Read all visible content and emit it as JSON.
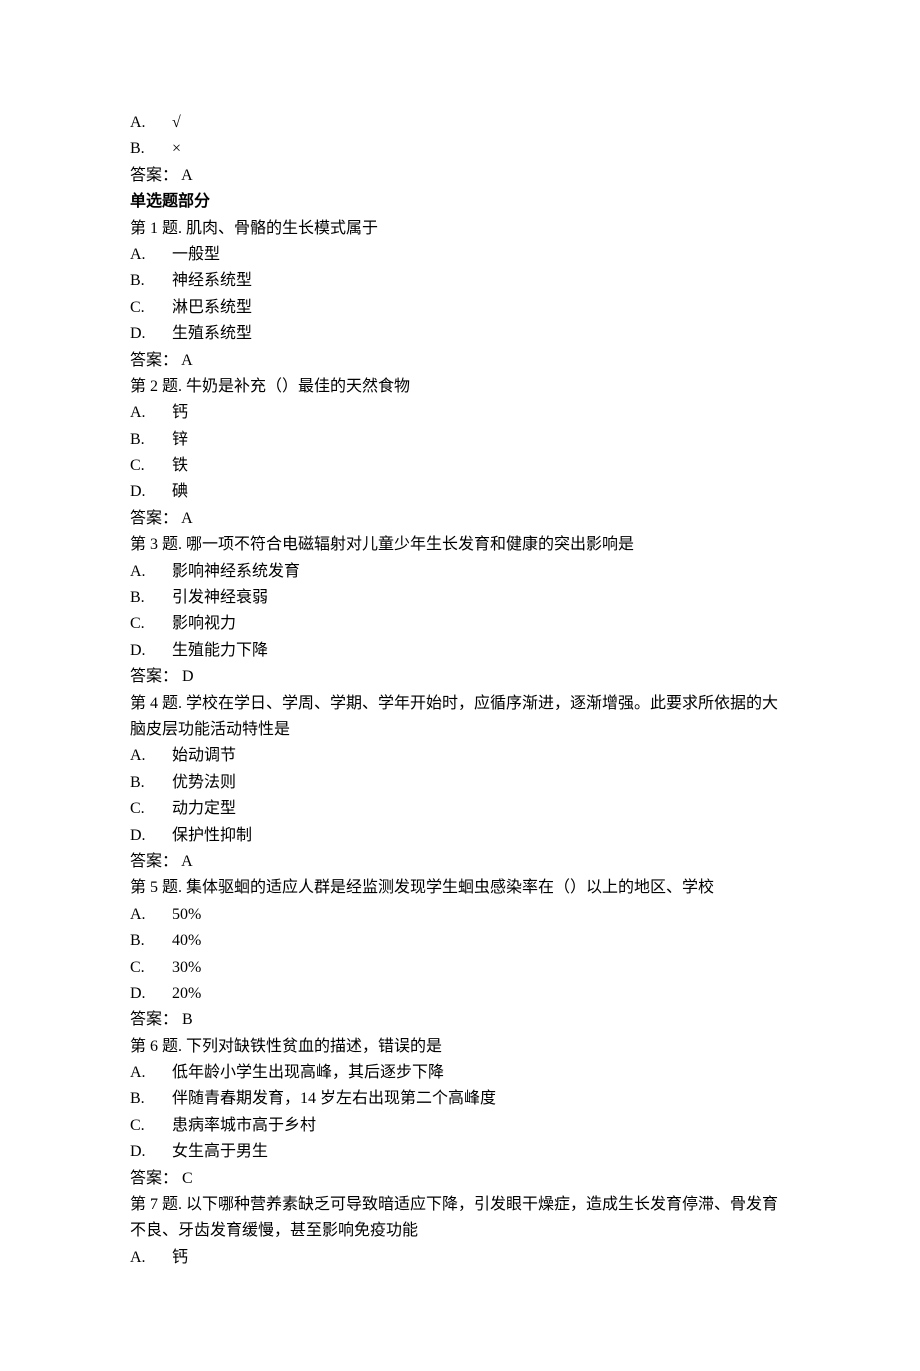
{
  "preamble": {
    "optA_label": "A.",
    "optA_text": "√",
    "optB_label": "B.",
    "optB_text": "×",
    "answer_label": "答案：",
    "answer_value": "A"
  },
  "section_header": "单选题部分",
  "questions": [
    {
      "num": "第 1 题.",
      "stem": "肌肉、骨骼的生长模式属于",
      "options": [
        {
          "label": "A.",
          "text": "一般型"
        },
        {
          "label": "B.",
          "text": "神经系统型"
        },
        {
          "label": "C.",
          "text": "淋巴系统型"
        },
        {
          "label": "D.",
          "text": "生殖系统型"
        }
      ],
      "answer_label": "答案：",
      "answer_value": "A"
    },
    {
      "num": "第 2 题.",
      "stem": "牛奶是补充（）最佳的天然食物",
      "options": [
        {
          "label": "A.",
          "text": "钙"
        },
        {
          "label": "B.",
          "text": "锌"
        },
        {
          "label": "C.",
          "text": "铁"
        },
        {
          "label": "D.",
          "text": "碘"
        }
      ],
      "answer_label": "答案：",
      "answer_value": "A"
    },
    {
      "num": "第 3 题.",
      "stem": "哪一项不符合电磁辐射对儿童少年生长发育和健康的突出影响是",
      "options": [
        {
          "label": "A.",
          "text": "影响神经系统发育"
        },
        {
          "label": "B.",
          "text": "引发神经衰弱"
        },
        {
          "label": "C.",
          "text": "影响视力"
        },
        {
          "label": "D.",
          "text": "生殖能力下降"
        }
      ],
      "answer_label": "答案：",
      "answer_value": "D"
    },
    {
      "num": "第 4 题.",
      "stem": "学校在学日、学周、学期、学年开始时，应循序渐进，逐渐增强。此要求所依据的大脑皮层功能活动特性是",
      "options": [
        {
          "label": "A.",
          "text": "始动调节"
        },
        {
          "label": "B.",
          "text": "优势法则"
        },
        {
          "label": "C.",
          "text": "动力定型"
        },
        {
          "label": "D.",
          "text": "保护性抑制"
        }
      ],
      "answer_label": "答案：",
      "answer_value": "A"
    },
    {
      "num": "第 5 题.",
      "stem": "集体驱蛔的适应人群是经监测发现学生蛔虫感染率在（）以上的地区、学校",
      "options": [
        {
          "label": "A.",
          "text": "50%"
        },
        {
          "label": "B.",
          "text": "40%"
        },
        {
          "label": "C.",
          "text": "30%"
        },
        {
          "label": "D.",
          "text": "20%"
        }
      ],
      "answer_label": "答案：",
      "answer_value": "B"
    },
    {
      "num": "第 6 题.",
      "stem": "下列对缺铁性贫血的描述，错误的是",
      "options": [
        {
          "label": "A.",
          "text": "低年龄小学生出现高峰，其后逐步下降"
        },
        {
          "label": "B.",
          "text": "伴随青春期发育，14 岁左右出现第二个高峰度"
        },
        {
          "label": "C.",
          "text": "患病率城市高于乡村"
        },
        {
          "label": "D.",
          "text": "女生高于男生"
        }
      ],
      "answer_label": "答案：",
      "answer_value": "C"
    },
    {
      "num": "第 7 题.",
      "stem": "以下哪种营养素缺乏可导致暗适应下降，引发眼干燥症，造成生长发育停滞、骨发育不良、牙齿发育缓慢，甚至影响免疫功能",
      "options": [
        {
          "label": "A.",
          "text": "钙"
        }
      ],
      "answer_label": "",
      "answer_value": ""
    }
  ]
}
